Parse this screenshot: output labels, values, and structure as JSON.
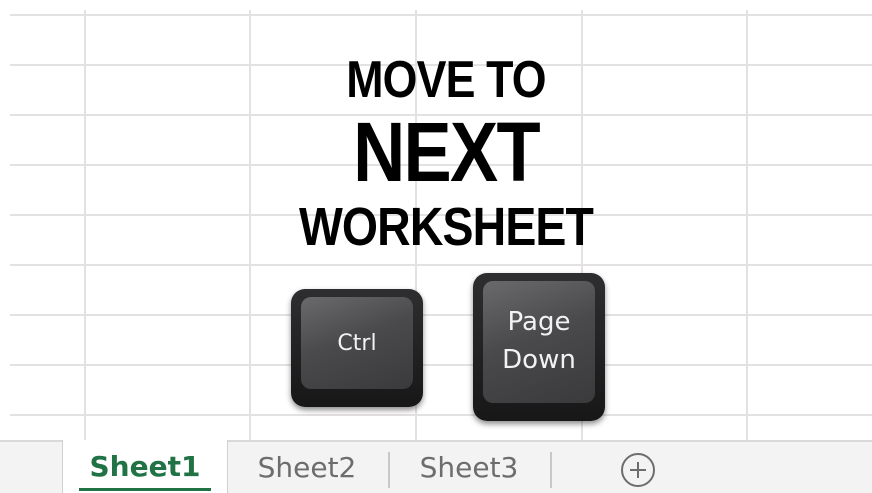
{
  "headline": {
    "line1": "MOVE TO",
    "line2": "NEXT",
    "line3": "WORKSHEET"
  },
  "keys": {
    "ctrl": "Ctrl",
    "page_down_line1": "Page",
    "page_down_line2": "Down"
  },
  "sheet_tabs": [
    {
      "label": "Sheet1",
      "active": true
    },
    {
      "label": "Sheet2",
      "active": false
    },
    {
      "label": "Sheet3",
      "active": false
    }
  ],
  "add_sheet_icon": "plus-circle-icon",
  "colors": {
    "active_tab_text": "#217346",
    "inactive_tab_text": "#6d6d6d",
    "gridline": "#e4e1e3",
    "headline": "#000000",
    "key_cap": "#4a4a4c"
  }
}
